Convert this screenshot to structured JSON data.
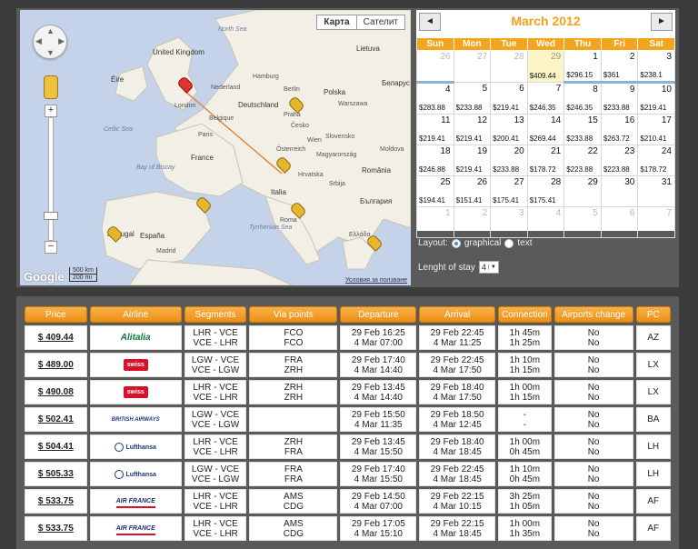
{
  "map": {
    "type_buttons": [
      "Карта",
      "Сателит"
    ],
    "google_logo": "Google",
    "scale_km": "500 km",
    "scale_mi": "200 mi",
    "terms": "Условия за ползване",
    "labels": {
      "north_sea": "North Sea",
      "celtic_sea": "Celtic Sea",
      "bay_of_biscay": "Bay of Biscay",
      "tyrrhenian_sea": "Tyrrhenian Sea",
      "united_kingdom": "United Kingdom",
      "eire": "Éire",
      "france": "France",
      "espana": "España",
      "portugal": "Portugal",
      "deutschland": "Deutschland",
      "polska": "Polska",
      "italia": "Italia",
      "romania": "România",
      "bulgaria": "България",
      "lietuva": "Lietuva",
      "belarus": "Беларус",
      "london": "London",
      "paris": "Paris",
      "nederland": "Nederland",
      "belgique": "Belgique",
      "cesko": "Česko",
      "slovensko": "Slovensko",
      "magyarorszag": "Magyarország",
      "srbija": "Srbija",
      "ellada": "Ελλάδα",
      "moldova": "Moldova",
      "osterreich": "Österreich",
      "hrvatska": "Hrvatska",
      "madrid": "Madrid",
      "roma": "Roma",
      "hamburg": "Hamburg",
      "berlin": "Berlin",
      "warszawa": "Warszawa",
      "praha": "Praha",
      "wien": "Wien"
    }
  },
  "calendar": {
    "title": "March 2012",
    "prev_icon": "◄",
    "next_icon": "►",
    "weekdays": [
      "Sun",
      "Mon",
      "Tue",
      "Wed",
      "Thu",
      "Fri",
      "Sat"
    ],
    "weeks": [
      [
        {
          "d": "26",
          "p": "",
          "other": true
        },
        {
          "d": "27",
          "p": "",
          "other": true
        },
        {
          "d": "28",
          "p": "",
          "other": true
        },
        {
          "d": "29",
          "p": "$409.44",
          "other": true,
          "sel": true
        },
        {
          "d": "1",
          "p": "$296.15"
        },
        {
          "d": "2",
          "p": "$361"
        },
        {
          "d": "3",
          "p": "$238.1"
        }
      ],
      [
        {
          "d": "4",
          "p": "$283.88"
        },
        {
          "d": "5",
          "p": "$233.88"
        },
        {
          "d": "6",
          "p": "$219.41"
        },
        {
          "d": "7",
          "p": "$246.35"
        },
        {
          "d": "8",
          "p": "$246.35"
        },
        {
          "d": "9",
          "p": "$233.88"
        },
        {
          "d": "10",
          "p": "$219.41"
        }
      ],
      [
        {
          "d": "11",
          "p": "$219.41"
        },
        {
          "d": "12",
          "p": "$219.41"
        },
        {
          "d": "13",
          "p": "$200.41"
        },
        {
          "d": "14",
          "p": "$269.44"
        },
        {
          "d": "15",
          "p": "$233.88"
        },
        {
          "d": "16",
          "p": "$263.72"
        },
        {
          "d": "17",
          "p": "$210.41"
        }
      ],
      [
        {
          "d": "18",
          "p": "$246.88"
        },
        {
          "d": "19",
          "p": "$219.41"
        },
        {
          "d": "20",
          "p": "$233.88"
        },
        {
          "d": "21",
          "p": "$178.72"
        },
        {
          "d": "22",
          "p": "$223.88"
        },
        {
          "d": "23",
          "p": "$223.88"
        },
        {
          "d": "24",
          "p": "$178.72"
        }
      ],
      [
        {
          "d": "25",
          "p": "$194.41"
        },
        {
          "d": "26",
          "p": "$151.41"
        },
        {
          "d": "27",
          "p": "$175.41"
        },
        {
          "d": "28",
          "p": "$175.41"
        },
        {
          "d": "29",
          "p": ""
        },
        {
          "d": "30",
          "p": ""
        },
        {
          "d": "31",
          "p": ""
        }
      ],
      [
        {
          "d": "1",
          "p": "",
          "other": true
        },
        {
          "d": "2",
          "p": "",
          "other": true
        },
        {
          "d": "3",
          "p": "",
          "other": true
        },
        {
          "d": "4",
          "p": "",
          "other": true
        },
        {
          "d": "5",
          "p": "",
          "other": true
        },
        {
          "d": "6",
          "p": "",
          "other": true
        },
        {
          "d": "7",
          "p": "",
          "other": true
        }
      ]
    ]
  },
  "options": {
    "layout_label": "Layout:",
    "graphical": "graphical",
    "text": "text",
    "stay_label": "Lenght of stay",
    "stay_value": "4"
  },
  "results": {
    "headers": [
      "Price",
      "Airline",
      "Segments",
      "Via points",
      "Departure",
      "Arrival",
      "Connection",
      "Airports change",
      "PC"
    ],
    "rows": [
      {
        "price": "$ 409.44",
        "airline": "Alitalia",
        "logo": "alitalia",
        "seg1": "LHR - VCE",
        "seg2": "VCE - LHR",
        "via1": "FCO",
        "via2": "FCO",
        "dep1": "29 Feb 16:25",
        "dep2": "4 Mar 07:00",
        "arr1": "29 Feb 22:45",
        "arr2": "4 Mar 11:25",
        "con1": "1h 45m",
        "con2": "1h 25m",
        "ch1": "No",
        "ch2": "No",
        "pc": "AZ"
      },
      {
        "price": "$ 489.00",
        "airline": "swiss",
        "logo": "swiss",
        "seg1": "LGW - VCE",
        "seg2": "VCE - LGW",
        "via1": "FRA",
        "via2": "ZRH",
        "dep1": "29 Feb 17:40",
        "dep2": "4 Mar 14:40",
        "arr1": "29 Feb 22:45",
        "arr2": "4 Mar 17:50",
        "con1": "1h 10m",
        "con2": "1h 15m",
        "ch1": "No",
        "ch2": "No",
        "pc": "LX"
      },
      {
        "price": "$ 490.08",
        "airline": "swiss",
        "logo": "swiss",
        "seg1": "LHR - VCE",
        "seg2": "VCE - LHR",
        "via1": "ZRH",
        "via2": "ZRH",
        "dep1": "29 Feb 13:45",
        "dep2": "4 Mar 14:40",
        "arr1": "29 Feb 18:40",
        "arr2": "4 Mar 17:50",
        "con1": "1h 00m",
        "con2": "1h 15m",
        "ch1": "No",
        "ch2": "No",
        "pc": "LX"
      },
      {
        "price": "$ 502.41",
        "airline": "BRITISH AIRWAYS",
        "logo": "ba",
        "seg1": "LGW - VCE",
        "seg2": "VCE - LGW",
        "via1": "",
        "via2": "",
        "dep1": "29 Feb 15:50",
        "dep2": "4 Mar 11:35",
        "arr1": "29 Feb 18:50",
        "arr2": "4 Mar 12:45",
        "con1": "-",
        "con2": "-",
        "ch1": "No",
        "ch2": "No",
        "pc": "BA"
      },
      {
        "price": "$ 504.41",
        "airline": "Lufthansa",
        "logo": "lh",
        "seg1": "LHR - VCE",
        "seg2": "VCE - LHR",
        "via1": "ZRH",
        "via2": "FRA",
        "dep1": "29 Feb 13:45",
        "dep2": "4 Mar 15:50",
        "arr1": "29 Feb 18:40",
        "arr2": "4 Mar 18:45",
        "con1": "1h 00m",
        "con2": "0h 45m",
        "ch1": "No",
        "ch2": "No",
        "pc": "LH"
      },
      {
        "price": "$ 505.33",
        "airline": "Lufthansa",
        "logo": "lh",
        "seg1": "LGW - VCE",
        "seg2": "VCE - LGW",
        "via1": "FRA",
        "via2": "FRA",
        "dep1": "29 Feb 17:40",
        "dep2": "4 Mar 15:50",
        "arr1": "29 Feb 22:45",
        "arr2": "4 Mar 18:45",
        "con1": "1h 10m",
        "con2": "0h 45m",
        "ch1": "No",
        "ch2": "No",
        "pc": "LH"
      },
      {
        "price": "$ 533.75",
        "airline": "AIR FRANCE",
        "logo": "af",
        "seg1": "LHR - VCE",
        "seg2": "VCE - LHR",
        "via1": "AMS",
        "via2": "CDG",
        "dep1": "29 Feb 14:50",
        "dep2": "4 Mar 07:00",
        "arr1": "29 Feb 22:15",
        "arr2": "4 Mar 10:15",
        "con1": "3h 25m",
        "con2": "1h 05m",
        "ch1": "No",
        "ch2": "No",
        "pc": "AF"
      },
      {
        "price": "$ 533.75",
        "airline": "AIR FRANCE",
        "logo": "af",
        "seg1": "LHR - VCE",
        "seg2": "VCE - LHR",
        "via1": "AMS",
        "via2": "CDG",
        "dep1": "29 Feb 17:05",
        "dep2": "4 Mar 15:10",
        "arr1": "29 Feb 22:15",
        "arr2": "4 Mar 18:45",
        "con1": "1h 00m",
        "con2": "1h 35m",
        "ch1": "No",
        "ch2": "No",
        "pc": "AF"
      }
    ]
  }
}
